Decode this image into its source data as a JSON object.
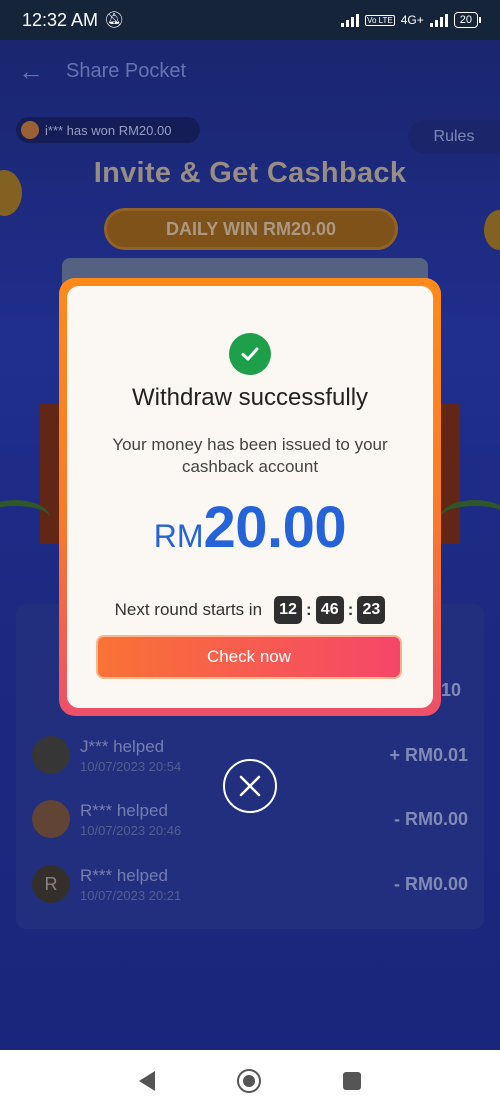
{
  "status_bar": {
    "time": "12:32 AM",
    "mute_icon": "bell-off-icon",
    "network": "4G+",
    "volte": "Vo LTE",
    "battery": "20"
  },
  "background": {
    "header_title": "Share Pocket",
    "ticker_text": "i*** has won RM20.00",
    "rules_label": "Rules",
    "hero_title": "Invite & Get Cashback",
    "daily_banner": "DAILY WIN RM20.00",
    "partial_amount": ".10",
    "history": [
      {
        "name": "J*** helped",
        "date": "10/07/2023 20:54",
        "amount": "+ RM0.01",
        "avatar": ""
      },
      {
        "name": "R*** helped",
        "date": "10/07/2023 20:46",
        "amount": "- RM0.00",
        "avatar": ""
      },
      {
        "name": "R*** helped",
        "date": "10/07/2023 20:21",
        "amount": "- RM0.00",
        "avatar": "R"
      }
    ]
  },
  "modal": {
    "title": "Withdraw successfully",
    "message": "Your money has been issued to your cashback account",
    "currency": "RM",
    "amount": "20.00",
    "countdown_label": "Next round starts in",
    "countdown": {
      "hours": "12",
      "minutes": "46",
      "seconds": "23"
    },
    "button_label": "Check now"
  },
  "colors": {
    "accent_blue": "#2563d9",
    "success_green": "#1ea04b",
    "modal_border_top": "#ff8a1a",
    "modal_border_bottom": "#ee4f6a"
  }
}
